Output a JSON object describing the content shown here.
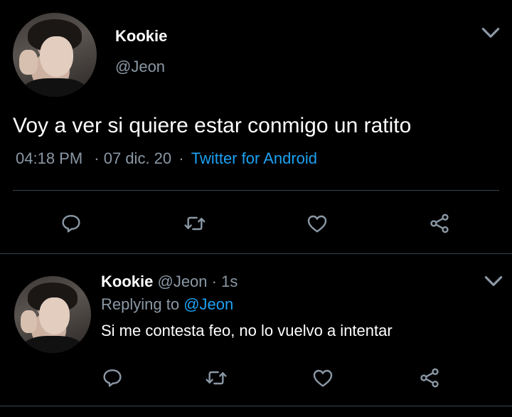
{
  "main_tweet": {
    "display_name": "Kookie",
    "handle": "@Jeon",
    "text": "Voy a ver si quiere estar conmigo un ratito",
    "time": "04:18 PM",
    "date": "· 07 dic. 20",
    "dot": "·",
    "source": "Twitter for Android"
  },
  "reply_tweet": {
    "display_name": "Kookie",
    "handle": "@Jeon",
    "time_ago": "· 1s",
    "replying_prefix": "Replying to",
    "replying_handle": "@Jeon",
    "text": "Si me contesta feo, no lo vuelvo a intentar"
  },
  "icons": {
    "menu": "chevron-down-icon",
    "reply": "reply-icon",
    "retweet": "retweet-icon",
    "like": "heart-icon",
    "share": "share-icon"
  },
  "colors": {
    "background": "#000000",
    "text": "#ffffff",
    "muted": "#8b98a5",
    "link": "#1da1f2",
    "divider": "#38444d"
  }
}
